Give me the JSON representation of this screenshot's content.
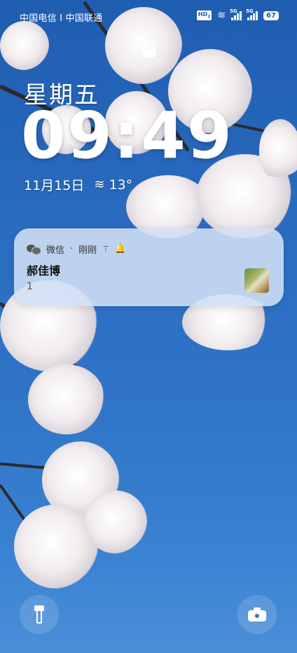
{
  "status_bar": {
    "carrier": "中国电信 I 中国联通",
    "hd_badge": "HD",
    "hd_sub": "2",
    "signal1_label": "5G",
    "signal2_label": "5G",
    "battery": "67"
  },
  "lock_screen": {
    "weekday": "星期五",
    "time": "09:49",
    "date": "11月15日",
    "weather_temp": "13°"
  },
  "notification": {
    "app": "微信",
    "separator": "·",
    "time": "刚刚",
    "sender": "郝佳博",
    "message": "1"
  },
  "icons": {
    "lock": "lock-icon",
    "wechat": "wechat-icon",
    "pin": "pin-icon",
    "bell": "bell-icon",
    "weather": "wind-icon",
    "flashlight": "flashlight-icon",
    "camera": "camera-icon"
  },
  "colors": {
    "sky_top": "#1f5db0",
    "sky_bottom": "#4a8fd8",
    "notification_bg": "#d2e0f5"
  }
}
